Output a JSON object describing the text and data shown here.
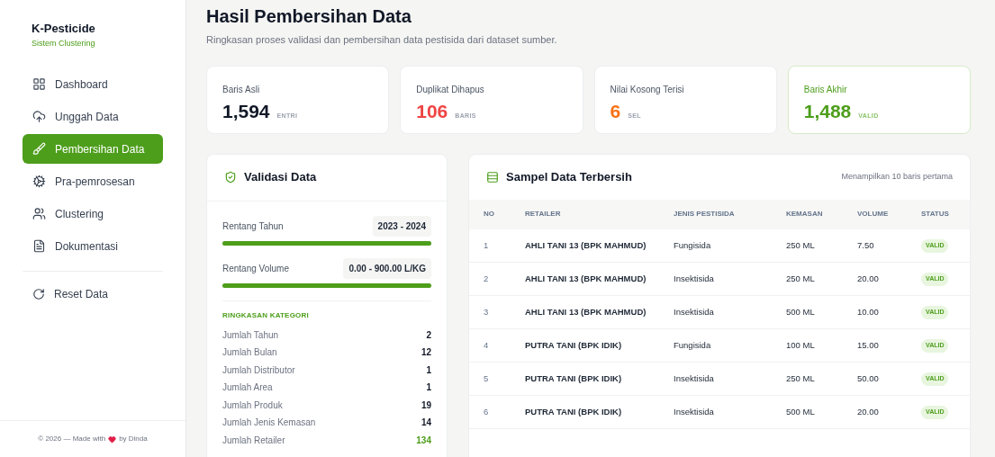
{
  "brand": {
    "title": "K-Pesticide",
    "subtitle": "Sistem Clustering"
  },
  "nav": [
    {
      "label": "Dashboard",
      "selected": false
    },
    {
      "label": "Unggah Data",
      "selected": false
    },
    {
      "label": "Pembersihan Data",
      "selected": true
    },
    {
      "label": "Pra-pemrosesan",
      "selected": false
    },
    {
      "label": "Clustering",
      "selected": false
    },
    {
      "label": "Dokumentasi",
      "selected": false
    }
  ],
  "reset": {
    "label": "Reset Data"
  },
  "footer": {
    "before": "© 2026 — Made with",
    "after": "by Dinda"
  },
  "page": {
    "title": "Hasil Pembersihan Data",
    "subtitle": "Ringkasan proses validasi dan pembersihan data pestisida dari dataset sumber."
  },
  "stats": [
    {
      "label": "Baris Asli",
      "value": "1,594",
      "unit": "ENTRI",
      "color": "#111827",
      "highlighted": false
    },
    {
      "label": "Duplikat Dihapus",
      "value": "106",
      "unit": "BARIS",
      "color": "#ef4444",
      "highlighted": false
    },
    {
      "label": "Nilai Kosong Terisi",
      "value": "6",
      "unit": "SEL",
      "color": "#f97316",
      "highlighted": false
    },
    {
      "label": "Baris Akhir",
      "value": "1,488",
      "unit": "VALID",
      "color": "#4d9e1b",
      "highlighted": true
    }
  ],
  "validation": {
    "title": "Validasi Data",
    "ranges": [
      {
        "label": "Rentang Tahun",
        "value": "2023 - 2024",
        "level": 1
      },
      {
        "label": "Rentang Volume",
        "value": "0.00 - 900.00 L/KG",
        "level": 1
      }
    ],
    "summary_title": "RINGKASAN KATEGORI",
    "summary": [
      {
        "label": "Jumlah Tahun",
        "value": "2",
        "highlighted": false
      },
      {
        "label": "Jumlah Bulan",
        "value": "12",
        "highlighted": false
      },
      {
        "label": "Jumlah Distributor",
        "value": "1",
        "highlighted": false
      },
      {
        "label": "Jumlah Area",
        "value": "1",
        "highlighted": false
      },
      {
        "label": "Jumlah Produk",
        "value": "19",
        "highlighted": false
      },
      {
        "label": "Jumlah Jenis Kemasan",
        "value": "14",
        "highlighted": false
      },
      {
        "label": "Jumlah Retailer",
        "value": "134",
        "highlighted": true
      }
    ]
  },
  "sample": {
    "title": "Sampel Data Terbersih",
    "note": "Menampilkan 10 baris pertama",
    "columns": [
      "NO",
      "RETAILER",
      "JENIS PESTISIDA",
      "KEMASAN",
      "VOLUME",
      "STATUS"
    ],
    "rows": [
      [
        "1",
        "AHLI TANI 13 (BPK MAHMUD)",
        "Fungisida",
        "250 ML",
        "7.50",
        "VALID"
      ],
      [
        "2",
        "AHLI TANI 13 (BPK MAHMUD)",
        "Insektisida",
        "250 ML",
        "20.00",
        "VALID"
      ],
      [
        "3",
        "AHLI TANI 13 (BPK MAHMUD)",
        "Insektisida",
        "500 ML",
        "10.00",
        "VALID"
      ],
      [
        "4",
        "PUTRA TANI (BPK IDIK)",
        "Fungisida",
        "100 ML",
        "15.00",
        "VALID"
      ],
      [
        "5",
        "PUTRA TANI (BPK IDIK)",
        "Insektisida",
        "250 ML",
        "50.00",
        "VALID"
      ],
      [
        "6",
        "PUTRA TANI (BPK IDIK)",
        "Insektisida",
        "500 ML",
        "20.00",
        "VALID"
      ]
    ]
  }
}
